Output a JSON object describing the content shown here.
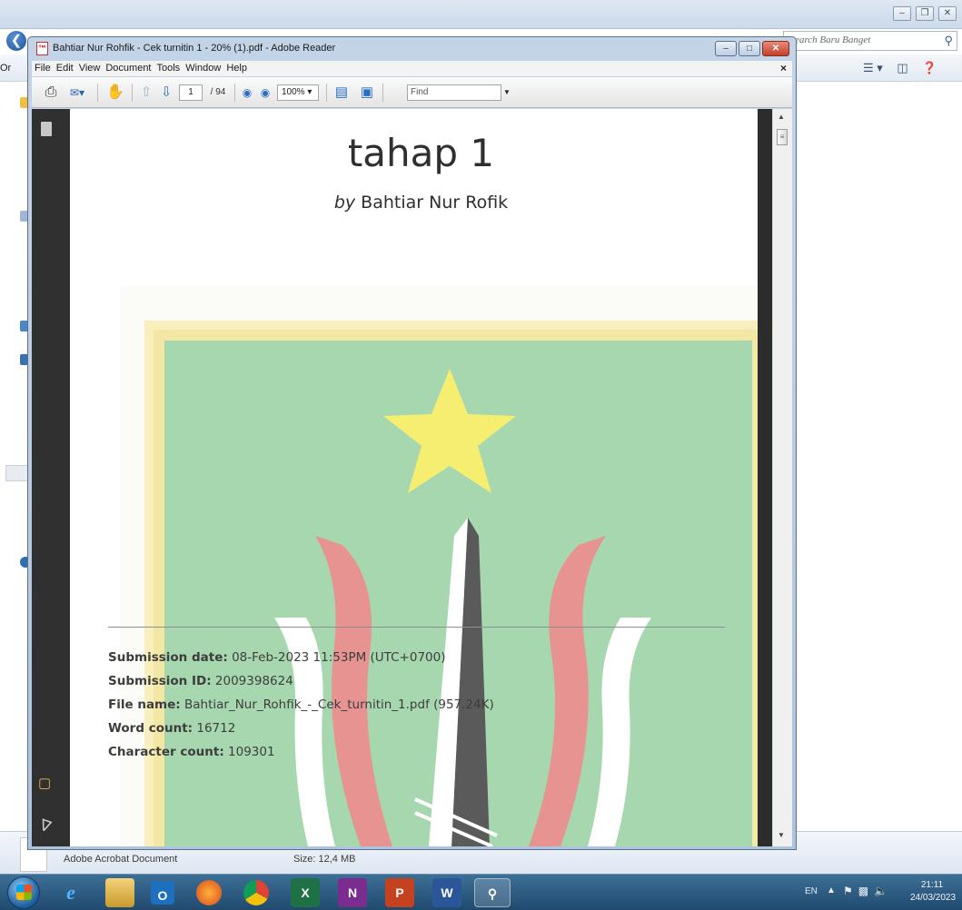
{
  "explorer": {
    "search_placeholder": "earch Baru Banget",
    "toolbar_partial_label": "Or",
    "details": {
      "file_type": "Adobe Acrobat Document",
      "size": "Size: 12,4 MB"
    }
  },
  "reader": {
    "title": "Bahtiar Nur Rohfik - Cek turnitin 1 - 20% (1).pdf - Adobe Reader",
    "menu": [
      "File",
      "Edit",
      "View",
      "Document",
      "Tools",
      "Window",
      "Help"
    ],
    "toolbar": {
      "current_page": "1",
      "page_total": "/ 94",
      "zoom": "100%",
      "find_placeholder": "Find"
    },
    "document": {
      "title": "tahap 1",
      "by_prefix": "by",
      "author": "Bahtiar Nur Rofik",
      "submission_date_label": "Submission date:",
      "submission_date_value": "08-Feb-2023 11:53PM (UTC+0700)",
      "submission_id_label": "Submission ID:",
      "submission_id_value": "2009398624",
      "file_name_label": "File name:",
      "file_name_value": "Bahtiar_Nur_Rohfik_-_Cek_turnitin_1.pdf (957.24K)",
      "word_count_label": "Word count:",
      "word_count_value": "16712",
      "character_count_label": "Character count:",
      "character_count_value": "109301"
    }
  },
  "taskbar": {
    "language": "EN",
    "time": "21:11",
    "date": "24/03/2023",
    "apps": [
      "ie-icon",
      "file-explorer-icon",
      "outlook-icon",
      "firefox-icon",
      "chrome-icon",
      "excel-icon",
      "onenote-icon",
      "powerpoint-icon",
      "word-icon",
      "adobe-reader-icon"
    ]
  },
  "colors": {
    "logo_green": "#9ed3a8",
    "logo_border_yellow": "#f6e9a8",
    "logo_star": "#f5ee6a",
    "logo_red": "#e88a8a",
    "logo_dark": "#5e5e5e",
    "nav_pane": "#303030"
  }
}
